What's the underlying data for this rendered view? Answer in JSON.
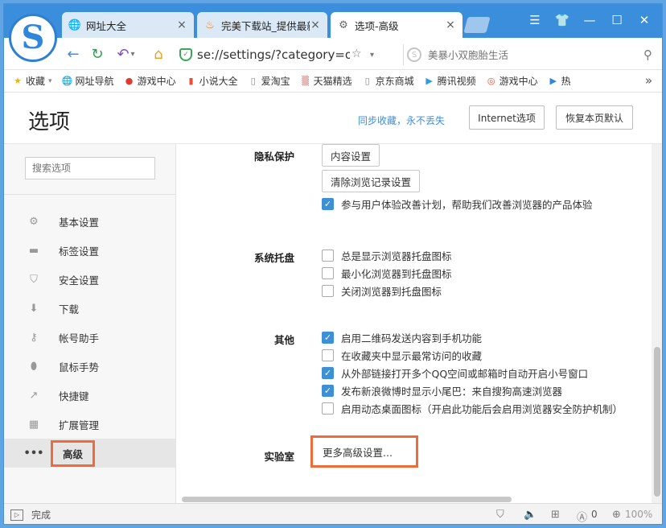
{
  "tabs": [
    {
      "title": "网址大全",
      "icon": "globe-icon",
      "active": false
    },
    {
      "title": "完美下载站_提供最新",
      "icon": "fire-icon",
      "active": false
    },
    {
      "title": "选项-高级",
      "icon": "gear-icon",
      "active": true
    }
  ],
  "address": {
    "url": "se://settings/?category=other",
    "search_placeholder": "美暴小双胞胎生活"
  },
  "bookmarks": [
    {
      "label": "收藏",
      "icon": "star-icon"
    },
    {
      "label": "网址导航",
      "icon": "globe-icon"
    },
    {
      "label": "游戏中心",
      "icon": "game-icon"
    },
    {
      "label": "小说大全",
      "icon": "book-icon"
    },
    {
      "label": "爱淘宝",
      "icon": "page-icon"
    },
    {
      "label": "天猫精选",
      "icon": "pattern-icon"
    },
    {
      "label": "京东商城",
      "icon": "page-icon"
    },
    {
      "label": "腾讯视频",
      "icon": "video-icon"
    },
    {
      "label": "游戏中心",
      "icon": "gamepad-icon"
    },
    {
      "label": "热",
      "icon": "play-icon"
    }
  ],
  "header": {
    "title": "选项",
    "sync_link": "同步收藏，永不丢失",
    "internet_options": "Internet选项",
    "restore_default": "恢复本页默认"
  },
  "sidebar": {
    "search_placeholder": "搜索选项",
    "items": [
      {
        "label": "基本设置",
        "icon": "gear-icon"
      },
      {
        "label": "标签设置",
        "icon": "tab-icon"
      },
      {
        "label": "安全设置",
        "icon": "shield-icon"
      },
      {
        "label": "下载",
        "icon": "download-icon"
      },
      {
        "label": "帐号助手",
        "icon": "key-icon"
      },
      {
        "label": "鼠标手势",
        "icon": "mouse-icon"
      },
      {
        "label": "快捷键",
        "icon": "shortcut-icon"
      },
      {
        "label": "扩展管理",
        "icon": "extension-icon"
      },
      {
        "label": "高级",
        "icon": "more-icon"
      }
    ]
  },
  "main": {
    "privacy": {
      "label": "隐私保护",
      "content_settings": "内容设置",
      "clear_history": "清除浏览记录设置",
      "options": [
        {
          "label": "参与用户体验改善计划，帮助我们改善浏览器的产品体验",
          "checked": true
        }
      ]
    },
    "tray": {
      "label": "系统托盘",
      "options": [
        {
          "label": "总是显示浏览器托盘图标",
          "checked": false
        },
        {
          "label": "最小化浏览器到托盘图标",
          "checked": false
        },
        {
          "label": "关闭浏览器到托盘图标",
          "checked": false
        }
      ]
    },
    "other": {
      "label": "其他",
      "options": [
        {
          "label": "启用二维码发送内容到手机功能",
          "checked": true
        },
        {
          "label": "在收藏夹中显示最常访问的收藏",
          "checked": false
        },
        {
          "label": "从外部链接打开多个QQ空间或邮箱时自动开启小号窗口",
          "checked": true
        },
        {
          "label": "发布新浪微博时显示小尾巴：来自搜狗高速浏览器",
          "checked": true
        },
        {
          "label": "启用动态桌面图标（开启此功能后会启用浏览器安全防护机制）",
          "checked": false
        }
      ]
    },
    "lab": {
      "label": "实验室",
      "button": "更多高级设置..."
    }
  },
  "status": {
    "text": "完成",
    "ad_count": "0",
    "zoom": "100%"
  }
}
